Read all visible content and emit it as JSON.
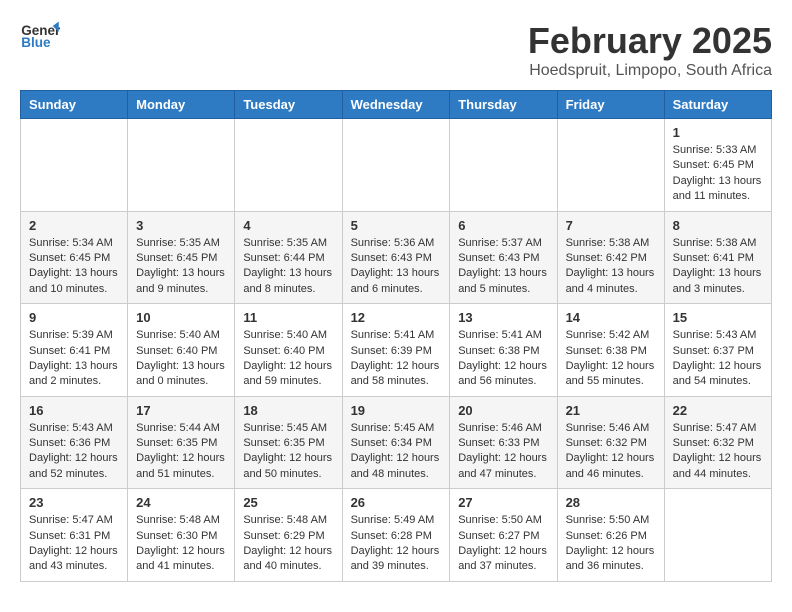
{
  "header": {
    "logo_general": "General",
    "logo_blue": "Blue",
    "month_title": "February 2025",
    "location": "Hoedspruit, Limpopo, South Africa"
  },
  "weekdays": [
    "Sunday",
    "Monday",
    "Tuesday",
    "Wednesday",
    "Thursday",
    "Friday",
    "Saturday"
  ],
  "weeks": [
    [
      {
        "day": "",
        "info": ""
      },
      {
        "day": "",
        "info": ""
      },
      {
        "day": "",
        "info": ""
      },
      {
        "day": "",
        "info": ""
      },
      {
        "day": "",
        "info": ""
      },
      {
        "day": "",
        "info": ""
      },
      {
        "day": "1",
        "info": "Sunrise: 5:33 AM\nSunset: 6:45 PM\nDaylight: 13 hours\nand 11 minutes."
      }
    ],
    [
      {
        "day": "2",
        "info": "Sunrise: 5:34 AM\nSunset: 6:45 PM\nDaylight: 13 hours\nand 10 minutes."
      },
      {
        "day": "3",
        "info": "Sunrise: 5:35 AM\nSunset: 6:45 PM\nDaylight: 13 hours\nand 9 minutes."
      },
      {
        "day": "4",
        "info": "Sunrise: 5:35 AM\nSunset: 6:44 PM\nDaylight: 13 hours\nand 8 minutes."
      },
      {
        "day": "5",
        "info": "Sunrise: 5:36 AM\nSunset: 6:43 PM\nDaylight: 13 hours\nand 6 minutes."
      },
      {
        "day": "6",
        "info": "Sunrise: 5:37 AM\nSunset: 6:43 PM\nDaylight: 13 hours\nand 5 minutes."
      },
      {
        "day": "7",
        "info": "Sunrise: 5:38 AM\nSunset: 6:42 PM\nDaylight: 13 hours\nand 4 minutes."
      },
      {
        "day": "8",
        "info": "Sunrise: 5:38 AM\nSunset: 6:41 PM\nDaylight: 13 hours\nand 3 minutes."
      }
    ],
    [
      {
        "day": "9",
        "info": "Sunrise: 5:39 AM\nSunset: 6:41 PM\nDaylight: 13 hours\nand 2 minutes."
      },
      {
        "day": "10",
        "info": "Sunrise: 5:40 AM\nSunset: 6:40 PM\nDaylight: 13 hours\nand 0 minutes."
      },
      {
        "day": "11",
        "info": "Sunrise: 5:40 AM\nSunset: 6:40 PM\nDaylight: 12 hours\nand 59 minutes."
      },
      {
        "day": "12",
        "info": "Sunrise: 5:41 AM\nSunset: 6:39 PM\nDaylight: 12 hours\nand 58 minutes."
      },
      {
        "day": "13",
        "info": "Sunrise: 5:41 AM\nSunset: 6:38 PM\nDaylight: 12 hours\nand 56 minutes."
      },
      {
        "day": "14",
        "info": "Sunrise: 5:42 AM\nSunset: 6:38 PM\nDaylight: 12 hours\nand 55 minutes."
      },
      {
        "day": "15",
        "info": "Sunrise: 5:43 AM\nSunset: 6:37 PM\nDaylight: 12 hours\nand 54 minutes."
      }
    ],
    [
      {
        "day": "16",
        "info": "Sunrise: 5:43 AM\nSunset: 6:36 PM\nDaylight: 12 hours\nand 52 minutes."
      },
      {
        "day": "17",
        "info": "Sunrise: 5:44 AM\nSunset: 6:35 PM\nDaylight: 12 hours\nand 51 minutes."
      },
      {
        "day": "18",
        "info": "Sunrise: 5:45 AM\nSunset: 6:35 PM\nDaylight: 12 hours\nand 50 minutes."
      },
      {
        "day": "19",
        "info": "Sunrise: 5:45 AM\nSunset: 6:34 PM\nDaylight: 12 hours\nand 48 minutes."
      },
      {
        "day": "20",
        "info": "Sunrise: 5:46 AM\nSunset: 6:33 PM\nDaylight: 12 hours\nand 47 minutes."
      },
      {
        "day": "21",
        "info": "Sunrise: 5:46 AM\nSunset: 6:32 PM\nDaylight: 12 hours\nand 46 minutes."
      },
      {
        "day": "22",
        "info": "Sunrise: 5:47 AM\nSunset: 6:32 PM\nDaylight: 12 hours\nand 44 minutes."
      }
    ],
    [
      {
        "day": "23",
        "info": "Sunrise: 5:47 AM\nSunset: 6:31 PM\nDaylight: 12 hours\nand 43 minutes."
      },
      {
        "day": "24",
        "info": "Sunrise: 5:48 AM\nSunset: 6:30 PM\nDaylight: 12 hours\nand 41 minutes."
      },
      {
        "day": "25",
        "info": "Sunrise: 5:48 AM\nSunset: 6:29 PM\nDaylight: 12 hours\nand 40 minutes."
      },
      {
        "day": "26",
        "info": "Sunrise: 5:49 AM\nSunset: 6:28 PM\nDaylight: 12 hours\nand 39 minutes."
      },
      {
        "day": "27",
        "info": "Sunrise: 5:50 AM\nSunset: 6:27 PM\nDaylight: 12 hours\nand 37 minutes."
      },
      {
        "day": "28",
        "info": "Sunrise: 5:50 AM\nSunset: 6:26 PM\nDaylight: 12 hours\nand 36 minutes."
      },
      {
        "day": "",
        "info": ""
      }
    ]
  ]
}
